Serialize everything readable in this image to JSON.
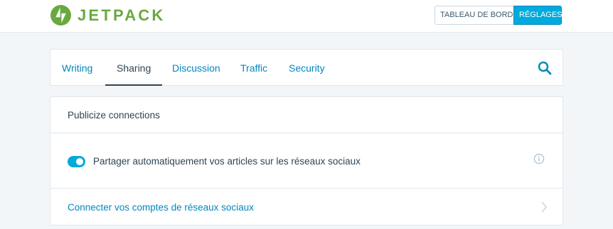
{
  "brand": {
    "name": "JETPACK",
    "color": "#69a93f",
    "icon": "jetpack-bolt-icon"
  },
  "header": {
    "dashboard_label": "TABLEAU DE BORD",
    "settings_label": "RÉGLAGES"
  },
  "nav": {
    "tabs": [
      {
        "label": "Writing",
        "active": false
      },
      {
        "label": "Sharing",
        "active": true
      },
      {
        "label": "Discussion",
        "active": false
      },
      {
        "label": "Traffic",
        "active": false
      },
      {
        "label": "Security",
        "active": false
      }
    ],
    "search_icon": "search-icon"
  },
  "card": {
    "title": "Publicize connections",
    "toggle": {
      "label": "Partager automatiquement vos articles sur les réseaux sociaux",
      "on": true
    },
    "info_icon": "info-icon",
    "link": {
      "label": "Connecter vos comptes de réseaux sociaux",
      "icon": "chevron-right-icon"
    }
  },
  "colors": {
    "accent": "#00aadc",
    "link": "#0087be",
    "text": "#2e4453",
    "background": "#f3f6f8"
  }
}
